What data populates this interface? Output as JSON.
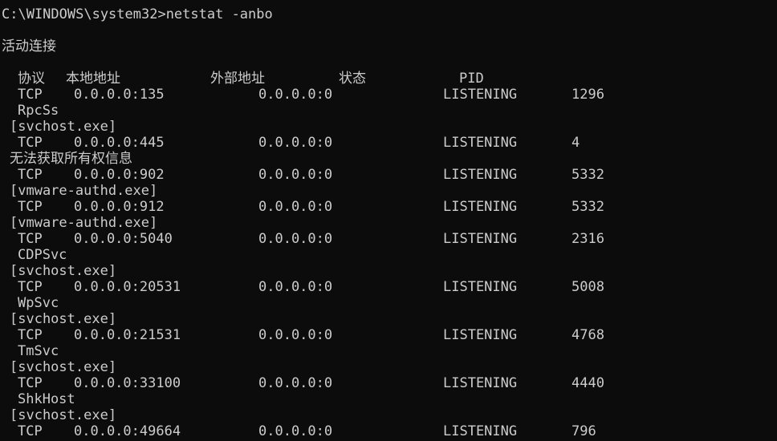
{
  "prompt": "C:\\WINDOWS\\system32>netstat -anbo",
  "section_title": "活动连接",
  "headers": {
    "proto": "协议",
    "local": "本地地址",
    "foreign": "外部地址",
    "state": "状态",
    "pid": "PID"
  },
  "rows": [
    {
      "proto": "TCP",
      "local": "0.0.0.0:135",
      "foreign": "0.0.0.0:0",
      "state": "LISTENING",
      "pid": "1296"
    },
    {
      "proto": "TCP",
      "local": "0.0.0.0:445",
      "foreign": "0.0.0.0:0",
      "state": "LISTENING",
      "pid": "4"
    },
    {
      "proto": "TCP",
      "local": "0.0.0.0:902",
      "foreign": "0.0.0.0:0",
      "state": "LISTENING",
      "pid": "5332"
    },
    {
      "proto": "TCP",
      "local": "0.0.0.0:912",
      "foreign": "0.0.0.0:0",
      "state": "LISTENING",
      "pid": "5332"
    },
    {
      "proto": "TCP",
      "local": "0.0.0.0:5040",
      "foreign": "0.0.0.0:0",
      "state": "LISTENING",
      "pid": "2316"
    },
    {
      "proto": "TCP",
      "local": "0.0.0.0:20531",
      "foreign": "0.0.0.0:0",
      "state": "LISTENING",
      "pid": "5008"
    },
    {
      "proto": "TCP",
      "local": "0.0.0.0:21531",
      "foreign": "0.0.0.0:0",
      "state": "LISTENING",
      "pid": "4768"
    },
    {
      "proto": "TCP",
      "local": "0.0.0.0:33100",
      "foreign": "0.0.0.0:0",
      "state": "LISTENING",
      "pid": "4440"
    },
    {
      "proto": "TCP",
      "local": "0.0.0.0:49664",
      "foreign": "0.0.0.0:0",
      "state": "LISTENING",
      "pid": "796"
    }
  ],
  "info": {
    "rpcss": "RpcSs",
    "svchost": "[svchost.exe]",
    "no_permission": "无法获取所有权信息",
    "vmware_authd": "[vmware-authd.exe]",
    "cdpsvc": "CDPSvc",
    "wpsvc": "WpSvc",
    "tmsvc": "TmSvc",
    "shkhost": "ShkHost"
  },
  "colors": {
    "background": "#0c0c0c",
    "foreground": "#cccccc"
  }
}
